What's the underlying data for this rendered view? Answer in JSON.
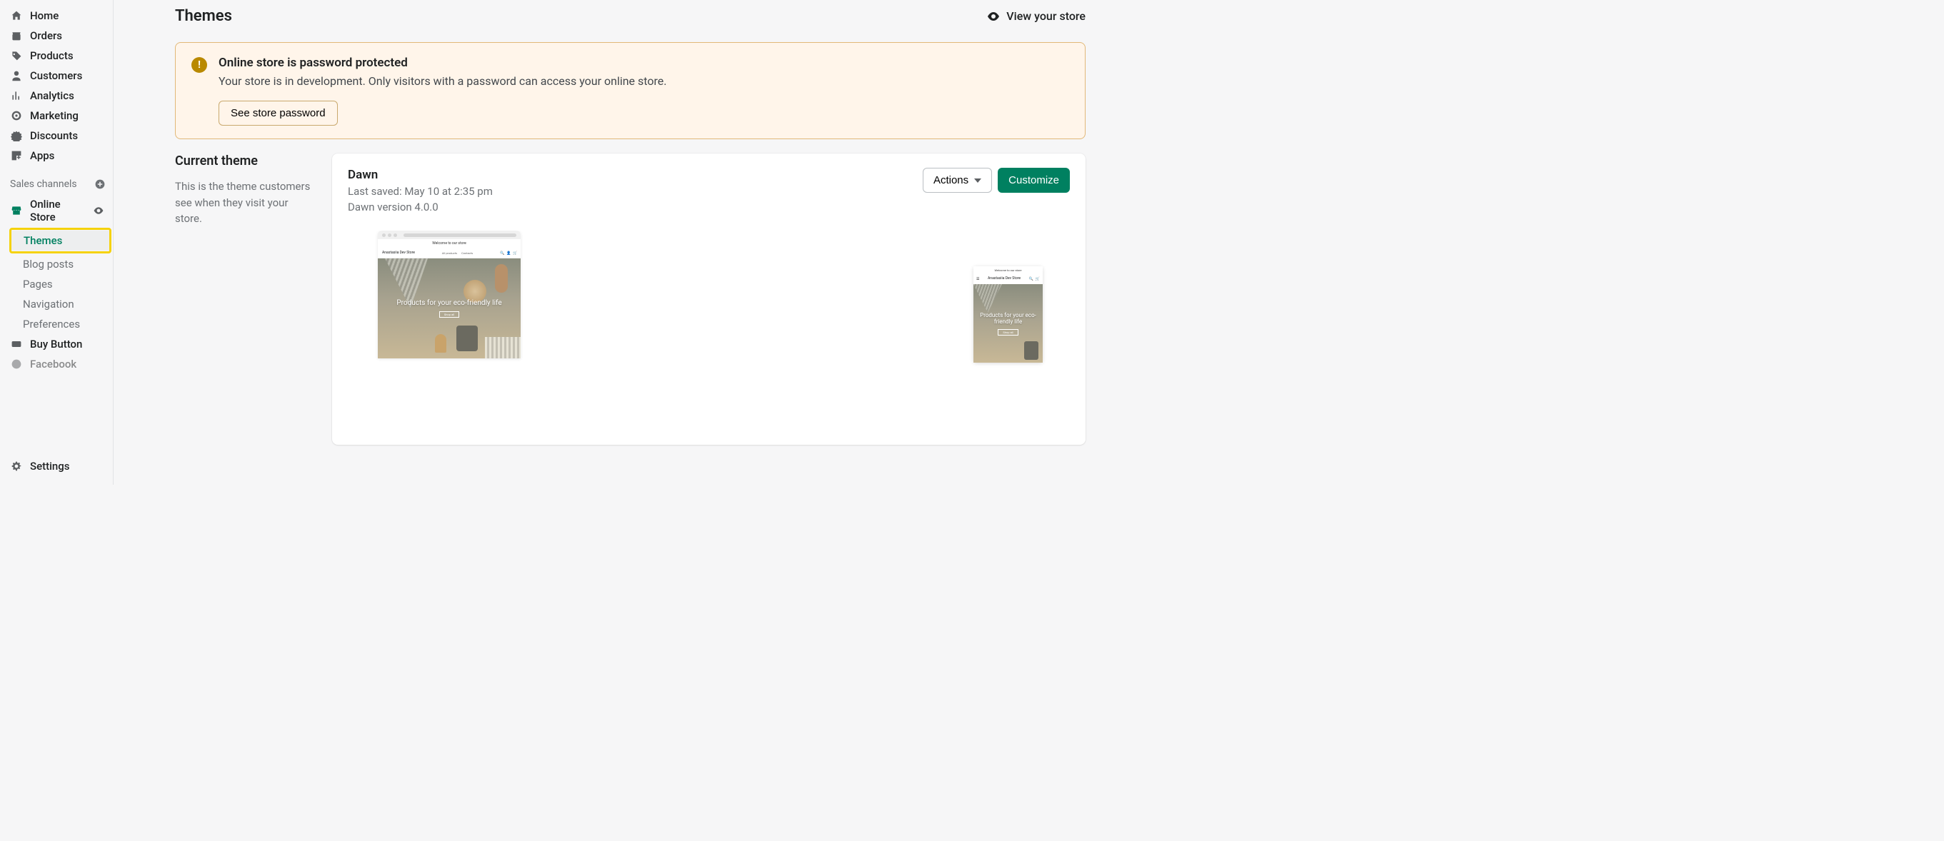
{
  "nav": {
    "home": "Home",
    "orders": "Orders",
    "products": "Products",
    "customers": "Customers",
    "analytics": "Analytics",
    "marketing": "Marketing",
    "discounts": "Discounts",
    "apps": "Apps",
    "settings": "Settings"
  },
  "sales_channels": {
    "header": "Sales channels",
    "online_store": "Online Store",
    "sub": {
      "themes": "Themes",
      "blog_posts": "Blog posts",
      "pages": "Pages",
      "navigation": "Navigation",
      "preferences": "Preferences"
    },
    "buy_button": "Buy Button",
    "facebook": "Facebook"
  },
  "page": {
    "title": "Themes",
    "view_store": "View your store"
  },
  "banner": {
    "title": "Online store is password protected",
    "text": "Your store is in development. Only visitors with a password can access your online store.",
    "button": "See store password"
  },
  "current": {
    "heading": "Current theme",
    "description": "This is the theme customers see when they visit your store."
  },
  "theme": {
    "name": "Dawn",
    "last_saved": "Last saved: May 10 at 2:35 pm",
    "version": "Dawn version 4.0.0",
    "actions_label": "Actions",
    "customize_label": "Customize"
  },
  "preview": {
    "announce": "Welcome to our store",
    "store_name": "Anastasiia Dev Store",
    "nav1": "All products",
    "nav2": "Contacts",
    "hero_text": "Products for your eco-friendly life",
    "hero_cta": "Shop all",
    "mobile_store_name": "Anastasiia Dev Store"
  }
}
